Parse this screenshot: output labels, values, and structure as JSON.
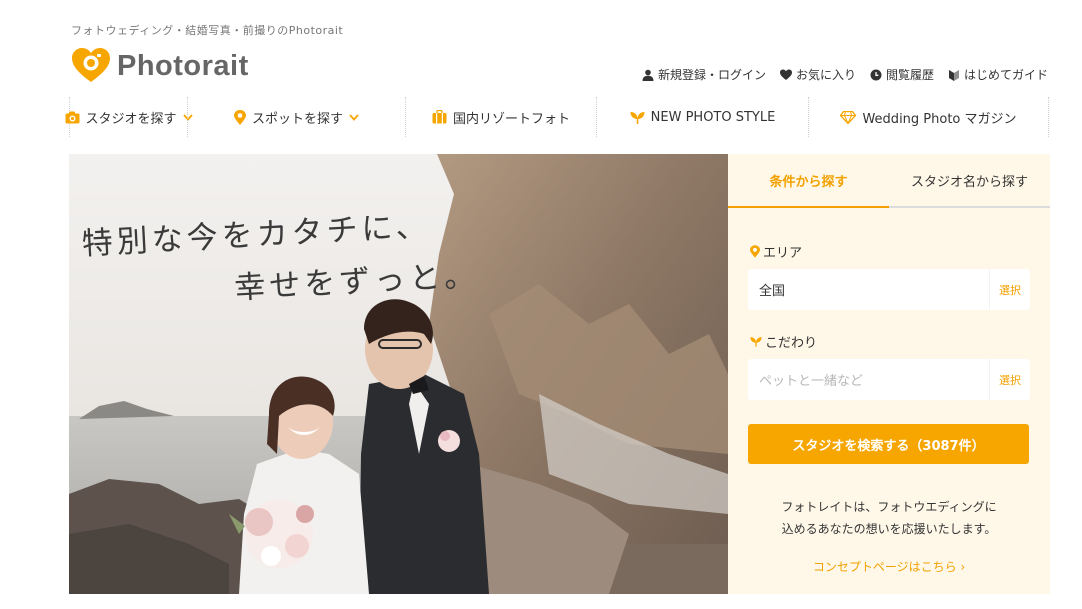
{
  "header": {
    "tagline": "フォトウェディング・結婚写真・前撮りのPhotorait",
    "logo_text": "Photorait",
    "brand_color": "#f7a600"
  },
  "util_nav": [
    {
      "icon": "person-icon",
      "label": "新規登録・ログイン"
    },
    {
      "icon": "heart-icon",
      "label": "お気に入り"
    },
    {
      "icon": "clock-icon",
      "label": "閲覧履歴"
    },
    {
      "icon": "beginner-mark-icon",
      "label": "はじめてガイド"
    }
  ],
  "main_nav": [
    {
      "icon": "camera-icon",
      "label": "スタジオを探す",
      "dropdown": true
    },
    {
      "icon": "map-pin-icon",
      "label": "スポットを探す",
      "dropdown": true
    },
    {
      "icon": "suitcase-icon",
      "label": "国内リゾートフォト",
      "dropdown": false
    },
    {
      "icon": "sprout-icon",
      "label": "NEW PHOTO STYLE",
      "dropdown": false
    },
    {
      "icon": "diamond-icon",
      "label": "Wedding Photo マガジン",
      "dropdown": false
    }
  ],
  "hero": {
    "copy_line1": "特別な今をカタチに、",
    "copy_line2": "幸せをずっと。"
  },
  "search": {
    "tabs": [
      "条件から探す",
      "スタジオ名から探す"
    ],
    "active_tab": 0,
    "area_label": "エリア",
    "area_value": "全国",
    "select_label": "選択",
    "kodawari_label": "こだわり",
    "kodawari_placeholder": "ペットと一緒など",
    "search_button": "スタジオを検索する（3087件）",
    "concept_line1": "フォトレイトは、フォトウエディングに",
    "concept_line2": "込めるあなたの想いを応援いたします。",
    "concept_link": "コンセプトページはこちら ›"
  }
}
